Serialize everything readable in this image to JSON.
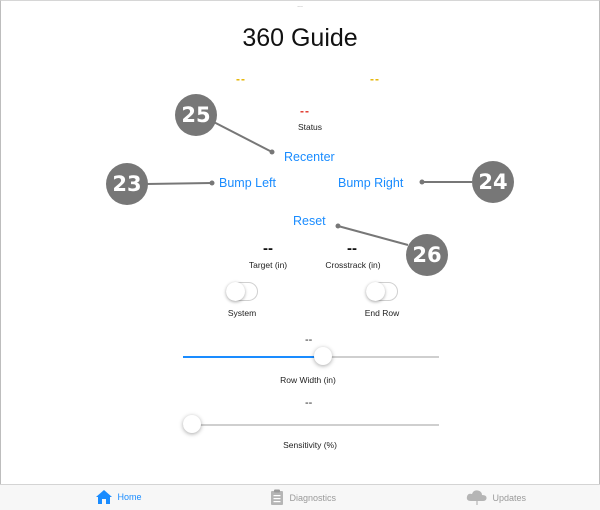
{
  "header": {
    "title": "360 Guide",
    "top_hint": "..."
  },
  "indicators": {
    "left": "--",
    "right": "--",
    "status_value": "--",
    "status_label": "Status"
  },
  "controls": {
    "recenter": "Recenter",
    "bump_left": "Bump Left",
    "bump_right": "Bump Right",
    "reset": "Reset"
  },
  "readouts": {
    "target_value": "--",
    "target_label": "Target (in)",
    "crosstrack_value": "--",
    "crosstrack_label": "Crosstrack (in)"
  },
  "toggles": {
    "system_label": "System",
    "system_on": false,
    "endrow_label": "End Row",
    "endrow_on": false
  },
  "sliders": {
    "row_width_value": "--",
    "row_width_label": "Row Width (in)",
    "row_width_fraction": 0.55,
    "sensitivity_value": "--",
    "sensitivity_label": "Sensitivity (%)",
    "sensitivity_fraction": 0.0
  },
  "callouts": {
    "c25": "25",
    "c23": "23",
    "c24": "24",
    "c26": "26"
  },
  "tabbar": {
    "home": "Home",
    "diagnostics": "Diagnostics",
    "updates": "Updates"
  },
  "colors": {
    "accent": "#1a8cff",
    "warn": "#e6b400",
    "error": "#e0372b",
    "callout": "#777777"
  },
  "icons": {
    "home": "home-icon",
    "diagnostics": "clipboard-icon",
    "updates": "cloud-download-icon"
  }
}
